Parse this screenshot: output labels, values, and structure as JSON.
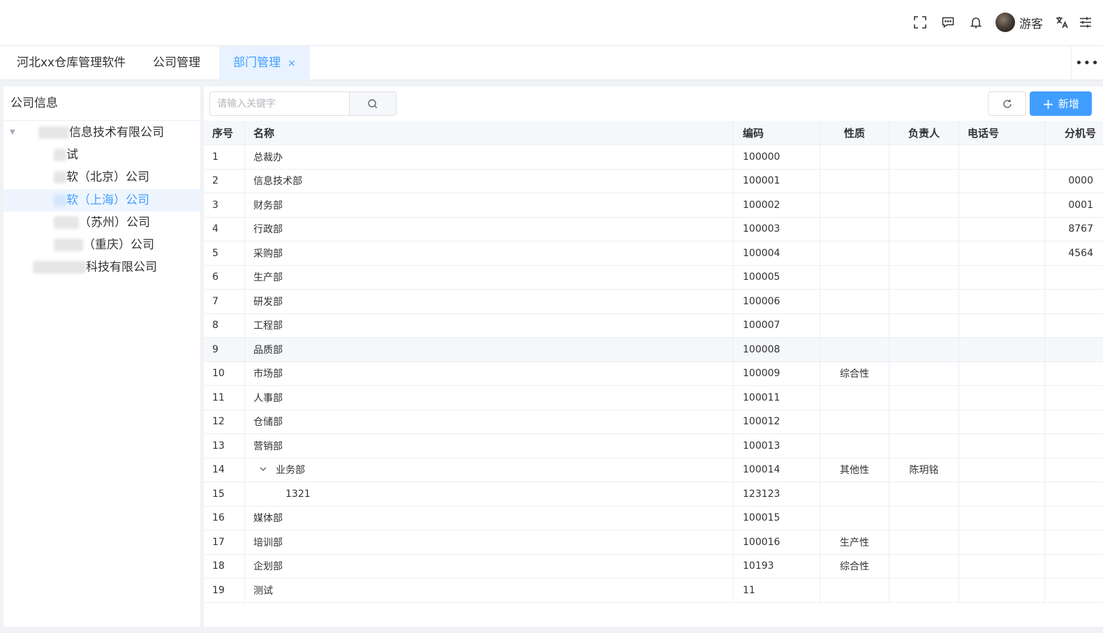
{
  "header": {
    "user_name": "游客",
    "icons": [
      "fullscreen-icon",
      "message-icon",
      "bell-icon",
      "translate-icon",
      "settings-sliders-icon"
    ]
  },
  "tabs": [
    {
      "label": "河北xx仓库管理软件"
    },
    {
      "label": "公司管理"
    },
    {
      "label": "部门管理",
      "close": "×"
    }
  ],
  "tabs_more": "•••",
  "left_panel": {
    "title": "公司信息",
    "tree": [
      {
        "label": "信息技术有限公司"
      },
      {
        "label": "试"
      },
      {
        "label": "软（北京）公司"
      },
      {
        "label": "软（上海）公司"
      },
      {
        "label": "（苏州）公司"
      },
      {
        "label": "（重庆）公司"
      },
      {
        "label": "科技有限公司"
      }
    ]
  },
  "toolbar": {
    "search_placeholder": "请输入关键字",
    "add_label": "新增"
  },
  "table": {
    "headers": [
      "序号",
      "名称",
      "编码",
      "性质",
      "负责人",
      "电话号",
      "分机号"
    ],
    "rows": [
      [
        "1",
        "总裁办",
        "100000",
        "",
        "",
        "",
        ""
      ],
      [
        "2",
        "信息技术部",
        "100001",
        "",
        "",
        "",
        "0000"
      ],
      [
        "3",
        "财务部",
        "100002",
        "",
        "",
        "",
        "0001"
      ],
      [
        "4",
        "行政部",
        "100003",
        "",
        "",
        "",
        "8767"
      ],
      [
        "5",
        "采购部",
        "100004",
        "",
        "",
        "",
        "4564"
      ],
      [
        "6",
        "生产部",
        "100005",
        "",
        "",
        "",
        ""
      ],
      [
        "7",
        "研发部",
        "100006",
        "",
        "",
        "",
        ""
      ],
      [
        "8",
        "工程部",
        "100007",
        "",
        "",
        "",
        ""
      ],
      [
        "9",
        "品质部",
        "100008",
        "",
        "",
        "",
        ""
      ],
      [
        "10",
        "市场部",
        "100009",
        "综合性",
        "",
        "",
        ""
      ],
      [
        "11",
        "人事部",
        "100011",
        "",
        "",
        "",
        ""
      ],
      [
        "12",
        "仓储部",
        "100012",
        "",
        "",
        "",
        ""
      ],
      [
        "13",
        "营销部",
        "100013",
        "",
        "",
        "",
        ""
      ],
      [
        "14",
        "业务部",
        "100014",
        "其他性",
        "陈玥铭",
        "",
        ""
      ],
      [
        "15",
        "1321",
        "123123",
        "",
        "",
        "",
        ""
      ],
      [
        "16",
        "媒体部",
        "100015",
        "",
        "",
        "",
        ""
      ],
      [
        "17",
        "培训部",
        "100016",
        "生产性",
        "",
        "",
        ""
      ],
      [
        "18",
        "企划部",
        "10193",
        "综合性",
        "",
        "",
        ""
      ],
      [
        "19",
        "测试",
        "11",
        "",
        "",
        "",
        ""
      ]
    ]
  },
  "colors": {
    "accent": "#409eff",
    "selected_bg": "#eef5ff",
    "tab_active_bg": "#e8f3ff"
  }
}
